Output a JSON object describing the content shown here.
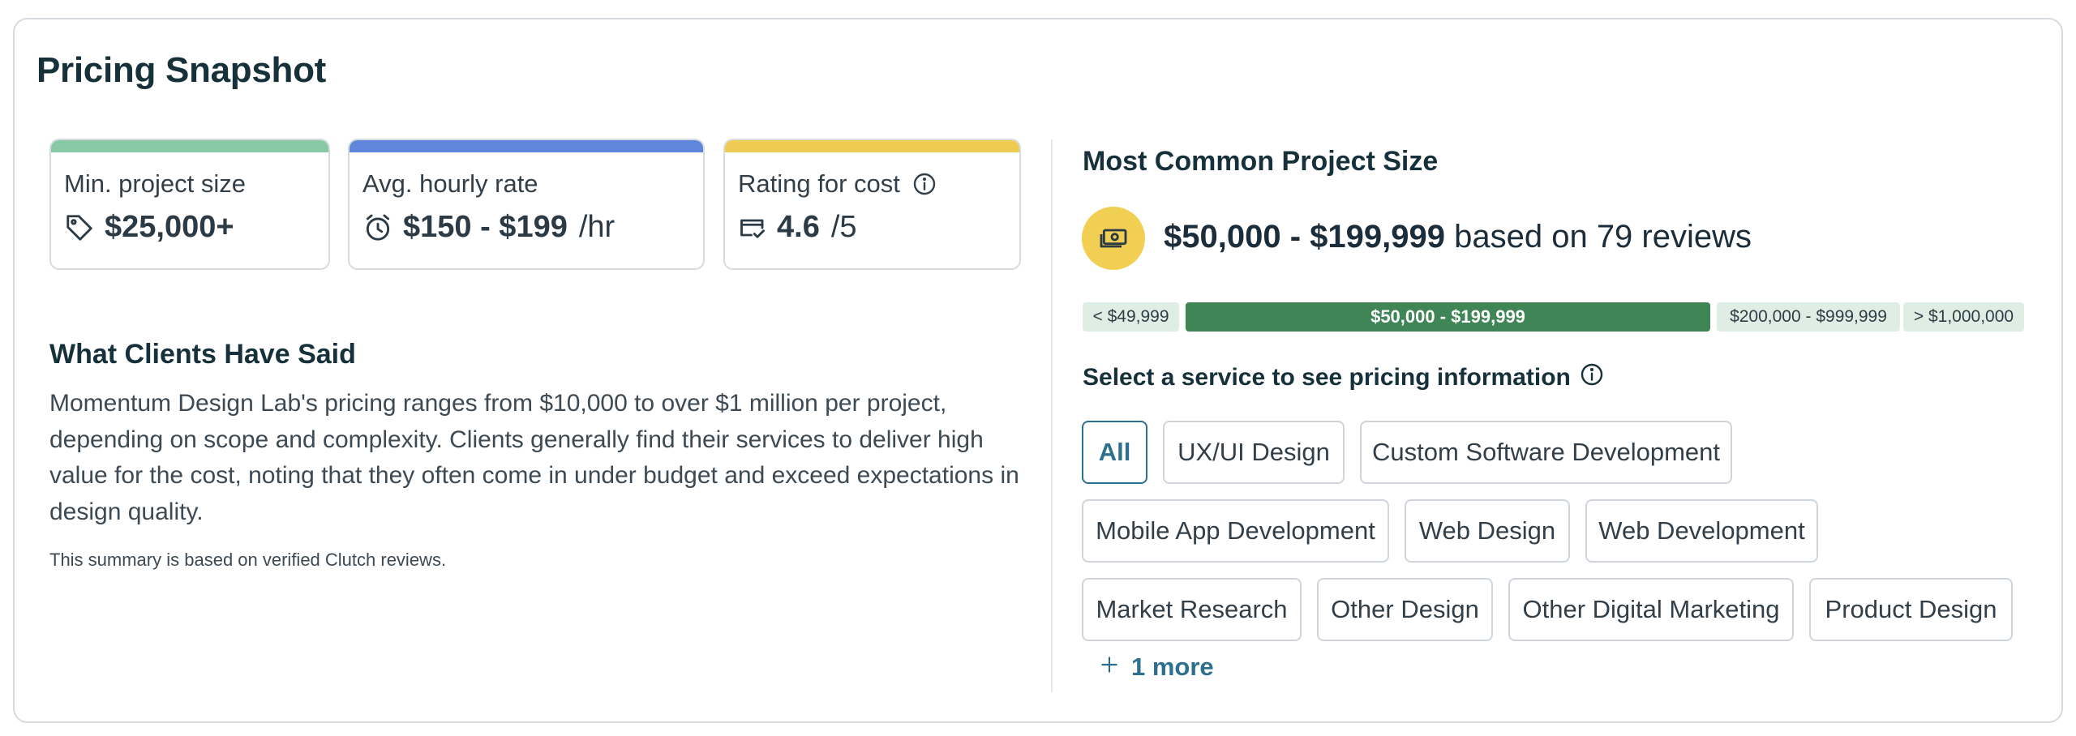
{
  "title": "Pricing Snapshot",
  "colors": {
    "min_bar": "#86c9a4",
    "hourly_bar": "#5f86db",
    "rating_bar": "#eecb52",
    "accent": "#2d6f8e",
    "range_active": "#3f8555"
  },
  "stats": {
    "min_project": {
      "label": "Min. project size",
      "value": "$25,000+",
      "icon": "tag-icon"
    },
    "hourly_rate": {
      "label": "Avg. hourly rate",
      "value": "$150 - $199",
      "unit": "/hr",
      "icon": "alarm-clock-icon"
    },
    "rating": {
      "label": "Rating for cost",
      "value": "4.6",
      "unit": "/5",
      "icon": "credit-card-check-icon",
      "info_icon": "info-icon"
    }
  },
  "clients": {
    "title": "What Clients Have Said",
    "body": "Momentum Design Lab's pricing ranges from $10,000 to over $1 million per project, depending on scope and complexity. Clients generally find their services to deliver high value for the cost, noting that they often come in under budget and exceed expectations in design quality.",
    "note": "This summary is based on verified Clutch reviews."
  },
  "common_size": {
    "title": "Most Common Project Size",
    "range": "$50,000 - $199,999",
    "suffix": "based on 79 reviews",
    "icon": "money-icon"
  },
  "ranges": [
    {
      "label": "< $49,999",
      "active": false
    },
    {
      "label": "$50,000 - $199,999",
      "active": true
    },
    {
      "label": "$200,000 - $999,999",
      "active": false
    },
    {
      "label": "> $1,000,000",
      "active": false
    }
  ],
  "services": {
    "prompt": "Select a service to see pricing information",
    "chips": [
      "All",
      "UX/UI Design",
      "Custom Software Development",
      "Mobile App Development",
      "Web Design",
      "Web Development",
      "Market Research",
      "Other Design",
      "Other Digital Marketing",
      "Product Design"
    ],
    "active": "All",
    "more": "1 more"
  }
}
